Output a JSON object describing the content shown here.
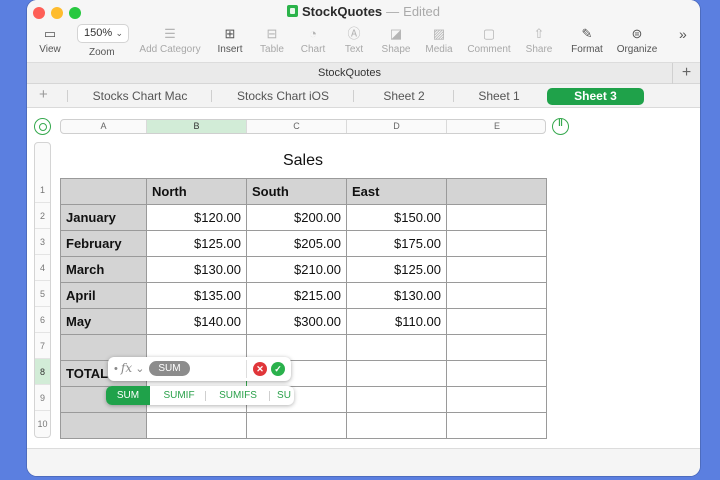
{
  "window": {
    "app_name": "StockQuotes",
    "separator": "—",
    "status": "Edited"
  },
  "toolbar": {
    "view": "View",
    "zoom_value": "150%",
    "zoom_label": "Zoom",
    "add_category": "Add Category",
    "insert": "Insert",
    "table": "Table",
    "chart": "Chart",
    "text": "Text",
    "shape": "Shape",
    "media": "Media",
    "comment": "Comment",
    "share": "Share",
    "format": "Format",
    "organize": "Organize"
  },
  "sheet_bar": {
    "name": "StockQuotes"
  },
  "tabs": [
    {
      "label": "Stocks Chart Mac"
    },
    {
      "label": "Stocks Chart iOS"
    },
    {
      "label": "Sheet 2"
    },
    {
      "label": "Sheet 1"
    },
    {
      "label": "Sheet 3",
      "active": true
    }
  ],
  "columns": [
    "A",
    "B",
    "C",
    "D",
    "E"
  ],
  "rows": [
    "1",
    "2",
    "3",
    "4",
    "5",
    "6",
    "7",
    "8",
    "9",
    "10"
  ],
  "table": {
    "title": "Sales",
    "headers": [
      "",
      "North",
      "South",
      "East",
      ""
    ],
    "data": [
      [
        "January",
        "$120.00",
        "$200.00",
        "$150.00",
        ""
      ],
      [
        "February",
        "$125.00",
        "$205.00",
        "$175.00",
        ""
      ],
      [
        "March",
        "$130.00",
        "$210.00",
        "$125.00",
        ""
      ],
      [
        "April",
        "$135.00",
        "$215.00",
        "$130.00",
        ""
      ],
      [
        "May",
        "$140.00",
        "$300.00",
        "$110.00",
        ""
      ]
    ],
    "total_label": "TOTAL"
  },
  "formula": {
    "fx_label": "fx",
    "token": "SUM",
    "suggestions": [
      "SUM",
      "SUMIF",
      "SUMIFS",
      "SU"
    ]
  },
  "colors": {
    "accent_green": "#1fa24a",
    "header_fill": "#d4d4d4",
    "desktop_blue": "#5b7fe0"
  }
}
